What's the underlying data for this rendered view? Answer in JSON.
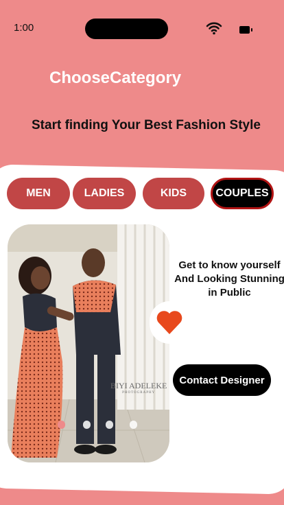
{
  "status_bar": {
    "time": "1:00",
    "icons": [
      "wifi-icon",
      "battery-icon"
    ]
  },
  "header": {
    "title": "ChooseCategory",
    "subtitle": "Start finding Your Best Fashion Style"
  },
  "tabs": [
    {
      "label": "MEN",
      "active": false
    },
    {
      "label": "LADIES",
      "active": false
    },
    {
      "label": "KIDS",
      "active": false
    },
    {
      "label": "COUPLES",
      "active": true
    }
  ],
  "feature": {
    "tagline": "Get to know yourself And Looking Stunning in Public",
    "contact_label": "Contact Designer",
    "photo_watermark": "BIYI ADELEKE",
    "photo_watermark_sub": "PHOTOGRAPHY",
    "carousel": {
      "count": 4,
      "active_index": 0
    }
  },
  "colors": {
    "background": "#ee8a8a",
    "tab": "#c14646",
    "tab_active": "#000000",
    "tab_active_border": "#b21414",
    "heart": "#e8491d",
    "active_dot": "#ee8a8a"
  }
}
